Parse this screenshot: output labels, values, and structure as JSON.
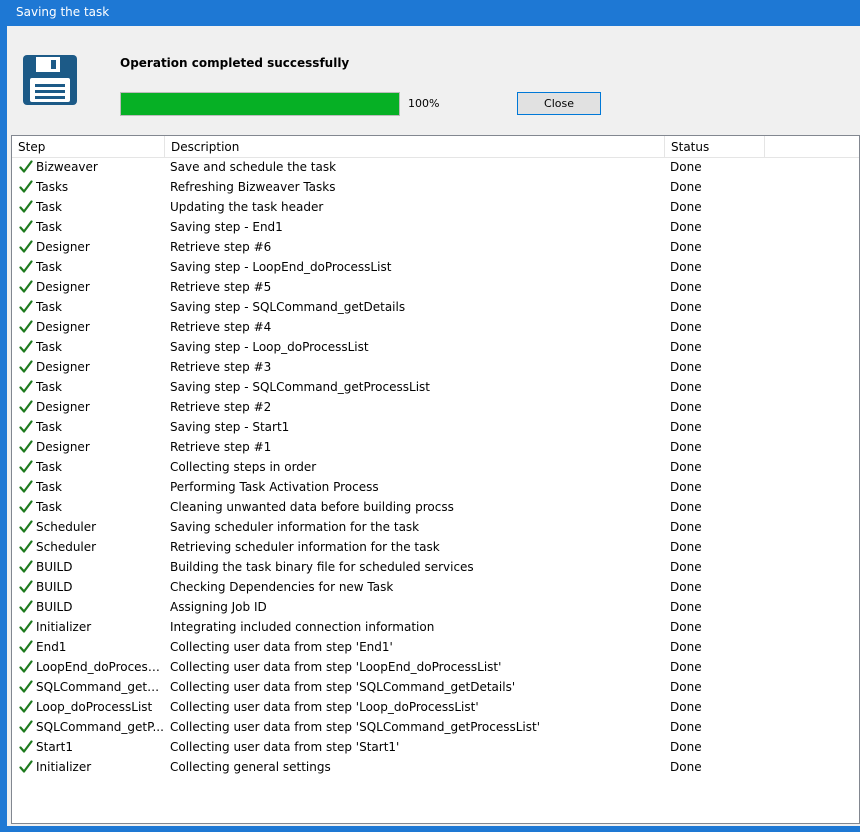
{
  "window": {
    "title": "Saving the task"
  },
  "status": {
    "message": "Operation completed successfully",
    "progress_percent": 100,
    "progress_label": "100%",
    "progress_color": "#06b025"
  },
  "buttons": {
    "close_label": "Close"
  },
  "icons": {
    "app_icon": "floppy-disk-save-icon",
    "row_icon": "checkmark-icon"
  },
  "colors": {
    "accent": "#1e78d4",
    "check": "#1e7a1e"
  },
  "table": {
    "columns": [
      "Step",
      "Description",
      "Status"
    ],
    "rows": [
      {
        "step": "Bizweaver",
        "description": "Save and schedule the task",
        "status": "Done"
      },
      {
        "step": "Tasks",
        "description": "Refreshing Bizweaver Tasks",
        "status": "Done"
      },
      {
        "step": "Task",
        "description": "Updating the task header",
        "status": "Done"
      },
      {
        "step": "Task",
        "description": "Saving step - End1",
        "status": "Done"
      },
      {
        "step": "Designer",
        "description": "Retrieve step #6",
        "status": "Done"
      },
      {
        "step": "Task",
        "description": "Saving step - LoopEnd_doProcessList",
        "status": "Done"
      },
      {
        "step": "Designer",
        "description": "Retrieve step #5",
        "status": "Done"
      },
      {
        "step": "Task",
        "description": "Saving step - SQLCommand_getDetails",
        "status": "Done"
      },
      {
        "step": "Designer",
        "description": "Retrieve step #4",
        "status": "Done"
      },
      {
        "step": "Task",
        "description": "Saving step - Loop_doProcessList",
        "status": "Done"
      },
      {
        "step": "Designer",
        "description": "Retrieve step #3",
        "status": "Done"
      },
      {
        "step": "Task",
        "description": "Saving step - SQLCommand_getProcessList",
        "status": "Done"
      },
      {
        "step": "Designer",
        "description": "Retrieve step #2",
        "status": "Done"
      },
      {
        "step": "Task",
        "description": "Saving step - Start1",
        "status": "Done"
      },
      {
        "step": "Designer",
        "description": "Retrieve step #1",
        "status": "Done"
      },
      {
        "step": "Task",
        "description": "Collecting steps in order",
        "status": "Done"
      },
      {
        "step": "Task",
        "description": "Performing Task Activation Process",
        "status": "Done"
      },
      {
        "step": "Task",
        "description": "Cleaning unwanted data before building procss",
        "status": "Done"
      },
      {
        "step": "Scheduler",
        "description": "Saving scheduler information for the task",
        "status": "Done"
      },
      {
        "step": "Scheduler",
        "description": "Retrieving scheduler information for the task",
        "status": "Done"
      },
      {
        "step": "BUILD",
        "description": "Building the task binary file for scheduled services",
        "status": "Done"
      },
      {
        "step": "BUILD",
        "description": "Checking Dependencies for new Task",
        "status": "Done"
      },
      {
        "step": "BUILD",
        "description": "Assigning Job ID",
        "status": "Done"
      },
      {
        "step": "Initializer",
        "description": "Integrating included connection information",
        "status": "Done"
      },
      {
        "step": "End1",
        "description": "Collecting user data from step 'End1'",
        "status": "Done"
      },
      {
        "step": "LoopEnd_doProcess...",
        "description": "Collecting user data from step 'LoopEnd_doProcessList'",
        "status": "Done"
      },
      {
        "step": "SQLCommand_getD...",
        "description": "Collecting user data from step 'SQLCommand_getDetails'",
        "status": "Done"
      },
      {
        "step": "Loop_doProcessList",
        "description": "Collecting user data from step 'Loop_doProcessList'",
        "status": "Done"
      },
      {
        "step": "SQLCommand_getP...",
        "description": "Collecting user data from step 'SQLCommand_getProcessList'",
        "status": "Done"
      },
      {
        "step": "Start1",
        "description": "Collecting user data from step 'Start1'",
        "status": "Done"
      },
      {
        "step": "Initializer",
        "description": "Collecting general settings",
        "status": "Done"
      }
    ]
  }
}
